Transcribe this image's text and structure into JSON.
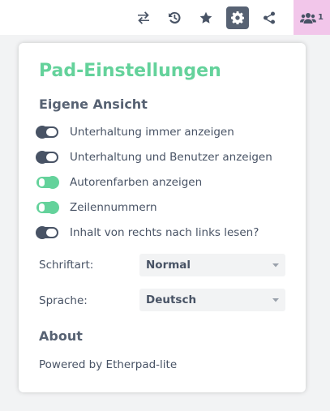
{
  "toolbar": {
    "icons": [
      "import-export-icon",
      "history-icon",
      "star-icon",
      "gear-icon",
      "share-icon",
      "users-icon"
    ],
    "user_count": "1",
    "active_color": "#576273",
    "users_bg": "#f2c6ea"
  },
  "settings": {
    "title": "Pad-Einstellungen",
    "own_view_heading": "Eigene Ansicht",
    "options": [
      {
        "label": "Unterhaltung immer anzeigen",
        "enabled": false
      },
      {
        "label": "Unterhaltung und Benutzer anzeigen",
        "enabled": false
      },
      {
        "label": "Autorenfarben anzeigen",
        "enabled": true
      },
      {
        "label": "Zeilennummern",
        "enabled": true
      },
      {
        "label": "Inhalt von rechts nach links lesen?",
        "enabled": false
      }
    ],
    "font": {
      "label": "Schriftart:",
      "value": "Normal"
    },
    "language": {
      "label": "Sprache:",
      "value": "Deutsch"
    },
    "about_heading": "About",
    "about_text": "Powered by Etherpad-lite",
    "accent_color": "#64d29b"
  }
}
